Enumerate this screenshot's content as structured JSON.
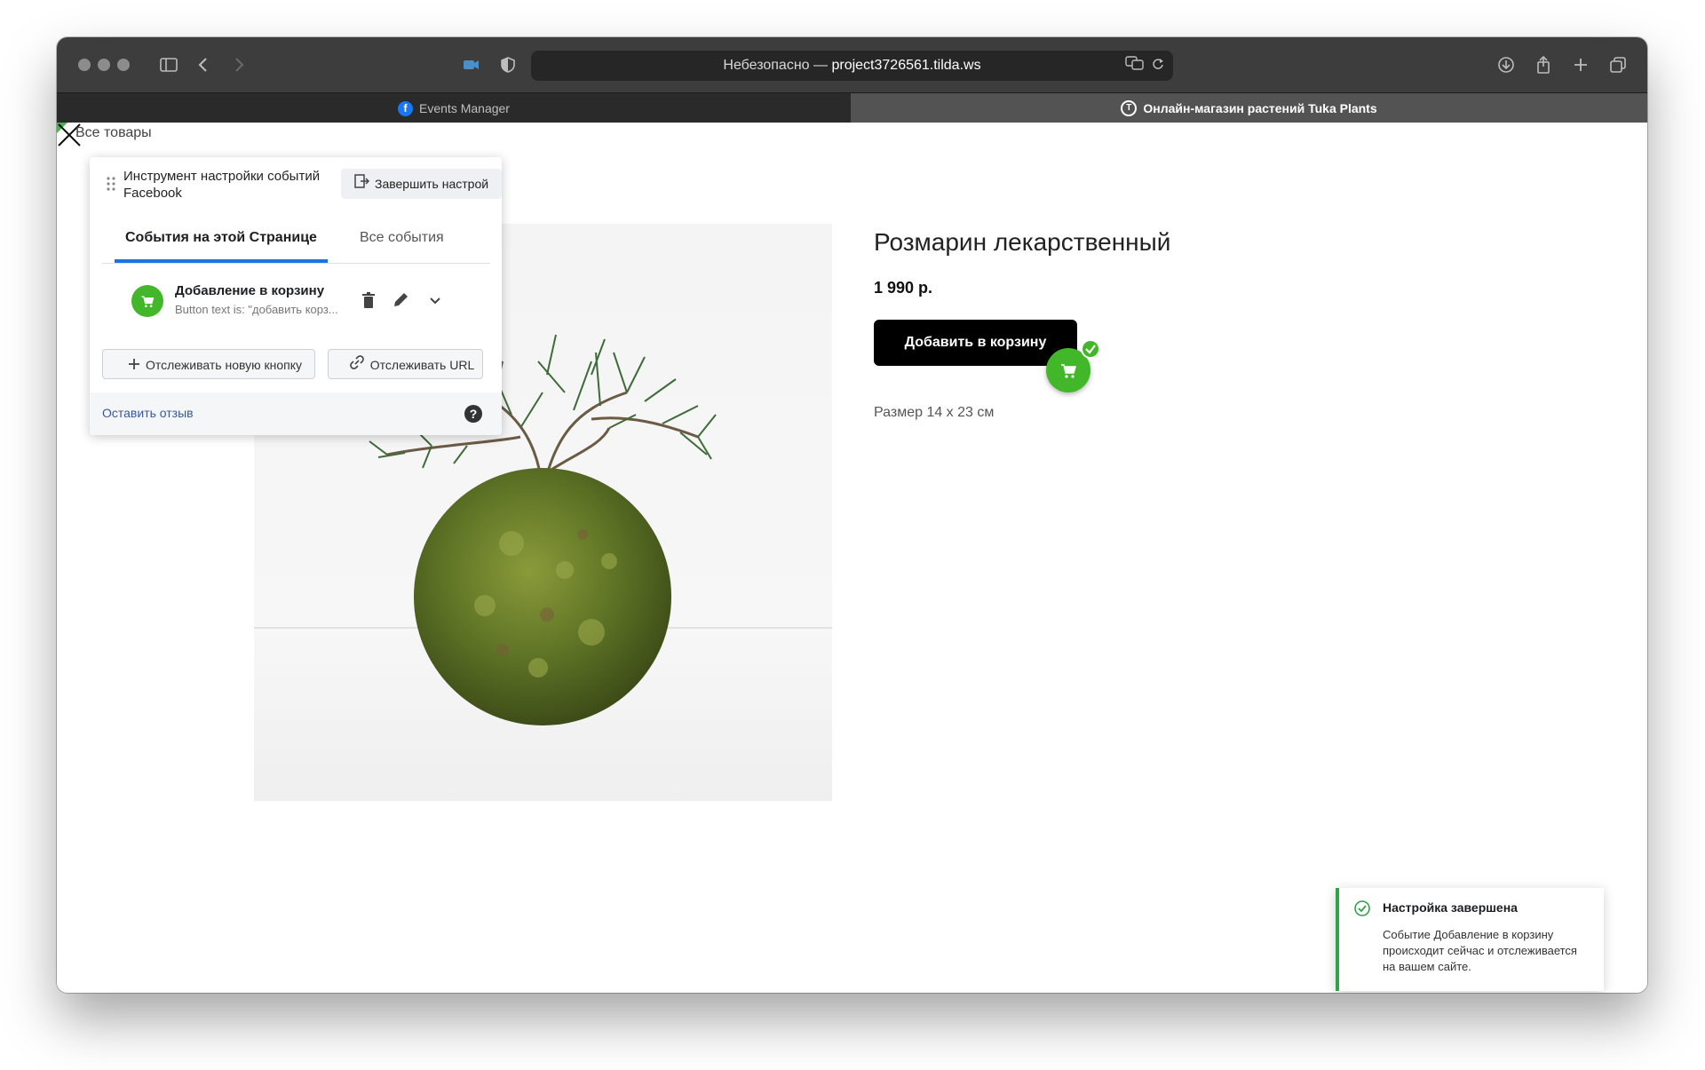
{
  "browser": {
    "url_prefix": "Небезопасно —",
    "url_host": "project3726561.tilda.ws",
    "tabs": [
      {
        "label": "Events Manager"
      },
      {
        "label": "Онлайн-магазин растений Tuka Plants"
      }
    ]
  },
  "page": {
    "back_link": "Все товары",
    "product_title": "Розмарин лекарственный",
    "price": "1 990 р.",
    "add_to_cart": "Добавить в корзину",
    "size": "Размер 14 х 23 см"
  },
  "fb_panel": {
    "title": "Инструмент настройки событий Facebook",
    "finish_button": "Завершить настрой",
    "tabs": [
      {
        "label": "События на этой Странице"
      },
      {
        "label": "Все события"
      }
    ],
    "event": {
      "name": "Добавление в корзину",
      "description": "Button text is: \"добавить корз..."
    },
    "track_button": "Отслеживать новую кнопку",
    "track_url": "Отслеживать URL",
    "feedback": "Оставить отзыв",
    "help": "?"
  },
  "toast": {
    "title": "Настройка завершена",
    "body": "Событие Добавление в корзину происходит сейчас и отслеживается на вашем сайте."
  },
  "colors": {
    "fb_green": "#42b72a",
    "fb_blue": "#1b74e4",
    "toast_accent": "#31a24c"
  }
}
